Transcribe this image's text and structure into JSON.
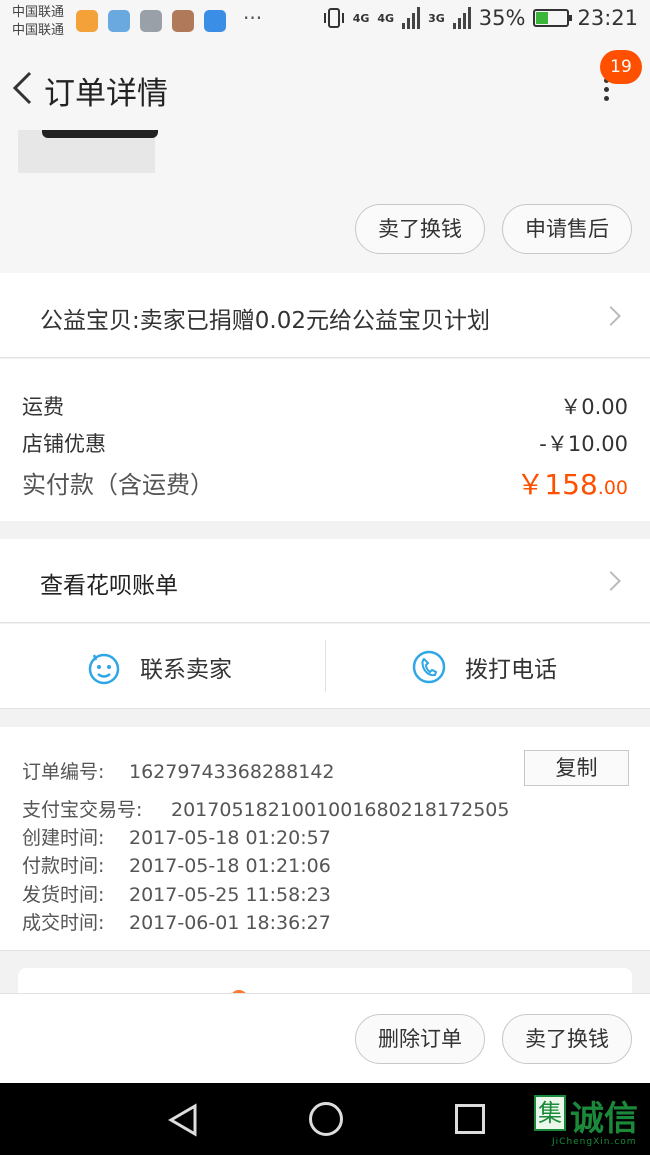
{
  "status_bar": {
    "carrier_1": "中国联通",
    "carrier_2": "中国联通",
    "dots": "···",
    "network_1": "4G",
    "network_2": "4G",
    "network_3": "3G",
    "battery": "35%",
    "time": "23:21"
  },
  "header": {
    "title": "订单详情",
    "badge": "19"
  },
  "product": {
    "sell_label": "卖了换钱",
    "after_sale_label": "申请售后"
  },
  "charity": {
    "text": "公益宝贝:卖家已捐赠0.02元给公益宝贝计划"
  },
  "fees": {
    "shipping_label": "运费",
    "shipping_value": "￥0.00",
    "discount_label": "店铺优惠",
    "discount_value": "-￥10.00",
    "total_label": "实付款（含运费）",
    "total_currency": "￥",
    "total_int": "158",
    "total_cents": ".00"
  },
  "huabei": {
    "label": "查看花呗账单"
  },
  "contact": {
    "seller_label": "联系卖家",
    "phone_label": "拨打电话"
  },
  "order": {
    "copy_label": "复制",
    "rows": [
      {
        "key": "订单编号:",
        "value": "16279743368288142"
      },
      {
        "key": "支付宝交易号:",
        "value": "2017051821001001680218172505"
      },
      {
        "key": "创建时间:",
        "value": "2017-05-18 01:20:57"
      },
      {
        "key": "付款时间:",
        "value": "2017-05-18 01:21:06"
      },
      {
        "key": "发货时间:",
        "value": "2017-05-25 11:58:23"
      },
      {
        "key": "成交时间:",
        "value": "2017-06-01 18:36:27"
      }
    ]
  },
  "actions": {
    "delete_label": "删除订单",
    "sell_label": "卖了换钱"
  },
  "watermark": {
    "logo_char": "集",
    "text": "诚信",
    "sub": "JiChengXin.com"
  },
  "colors": {
    "accent": "#ff5000",
    "contact_icon": "#2fa7e6"
  }
}
